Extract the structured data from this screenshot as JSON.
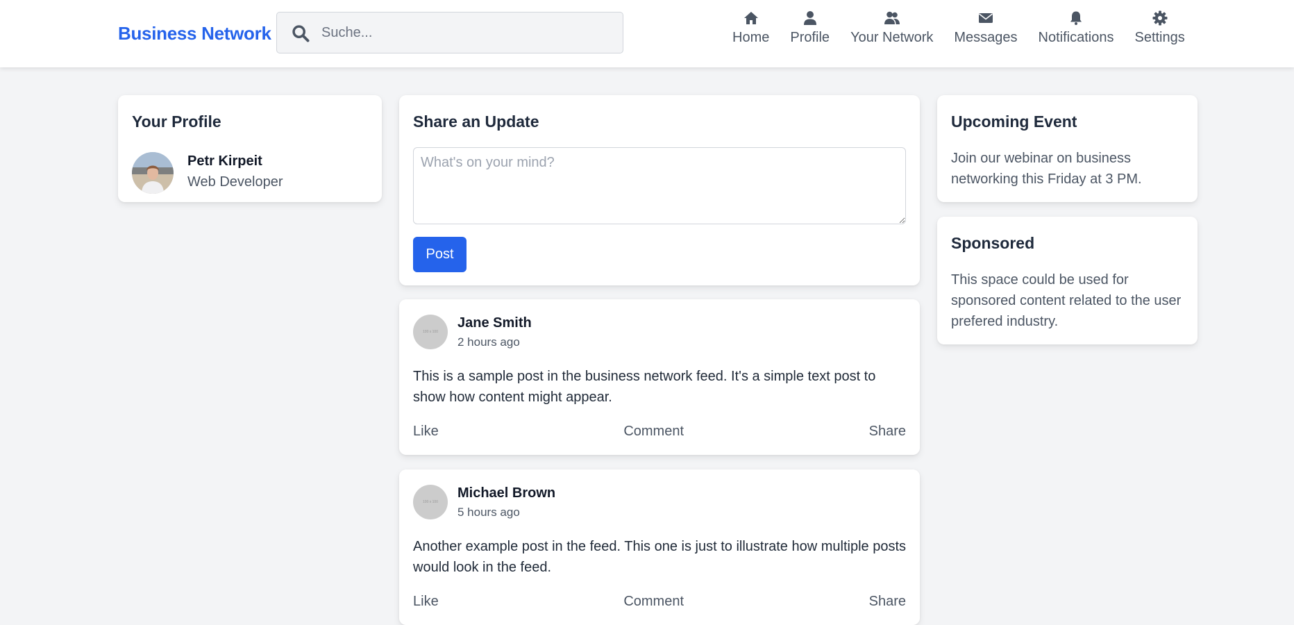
{
  "header": {
    "brand": "Business Network",
    "search": {
      "placeholder": "Suche...",
      "value": ""
    },
    "nav": [
      {
        "label": "Home",
        "icon": "home-icon"
      },
      {
        "label": "Profile",
        "icon": "user-icon"
      },
      {
        "label": "Your Network",
        "icon": "users-icon"
      },
      {
        "label": "Messages",
        "icon": "envelope-icon"
      },
      {
        "label": "Notifications",
        "icon": "bell-icon"
      },
      {
        "label": "Settings",
        "icon": "gear-icon"
      }
    ]
  },
  "profile": {
    "title": "Your Profile",
    "name": "Petr Kirpeit",
    "role": "Web Developer"
  },
  "share": {
    "title": "Share an Update",
    "placeholder": "What's on your mind?",
    "value": "",
    "post_label": "Post"
  },
  "posts": [
    {
      "author": "Jane Smith",
      "time": "2 hours ago",
      "avatar_text": "100 x 100",
      "text": "This is a sample post in the business network feed. It's a simple text post to show how content might appear.",
      "actions": {
        "like": "Like",
        "comment": "Comment",
        "share": "Share"
      }
    },
    {
      "author": "Michael Brown",
      "time": "5 hours ago",
      "avatar_text": "100 x 100",
      "text": "Another example post in the feed. This one is just to illustrate how multiple posts would look in the feed.",
      "actions": {
        "like": "Like",
        "comment": "Comment",
        "share": "Share"
      }
    }
  ],
  "event": {
    "title": "Upcoming Event",
    "text": "Join our webinar on business networking this Friday at 3 PM."
  },
  "sponsored": {
    "title": "Sponsored",
    "text": "This space could be used for sponsored content related to the user prefered industry."
  },
  "colors": {
    "brand": "#2563eb",
    "background": "#f3f4f6",
    "nav_text": "#4b5563"
  }
}
